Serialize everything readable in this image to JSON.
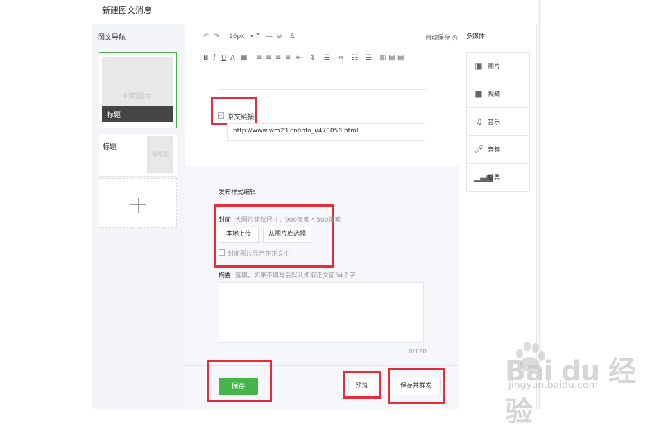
{
  "page": {
    "title": "新建图文消息"
  },
  "nav": {
    "header": "图文导航",
    "cover_card": {
      "placeholder": "封面图片",
      "title": "标题"
    },
    "sub_card": {
      "title": "标题",
      "thumb": "缩略图"
    }
  },
  "toolbar": {
    "font_size": "16px",
    "autosave": "自动保存"
  },
  "article": {
    "original_link": {
      "label": "原文链接",
      "checked": true,
      "url": "http://www.wm23.cn/info_i/470056.html"
    }
  },
  "publish": {
    "section_title": "发布样式编辑",
    "cover": {
      "label": "封面",
      "hint": "大图片建议尺寸：900像素 * 500像素",
      "upload_label": "本地上传",
      "library_label": "从图片库选择",
      "show_in_body_label": "封面图片显示在正文中"
    },
    "summary": {
      "label": "摘要",
      "hint": "选填，如果不填写会默认抓取正文前54个字",
      "counter": "0/120"
    }
  },
  "footer": {
    "save_label": "保存",
    "preview_label": "预览",
    "save_send_label": "保存并群发"
  },
  "media": {
    "header": "多媒体",
    "items": [
      {
        "icon": "image-icon",
        "label": "图片"
      },
      {
        "icon": "video-icon",
        "label": "视频"
      },
      {
        "icon": "music-icon",
        "label": "音乐"
      },
      {
        "icon": "microphone-icon",
        "label": "音频"
      },
      {
        "icon": "poll-icon",
        "label": "投票"
      }
    ]
  },
  "watermark": {
    "brand": "Bai du 经验",
    "url": "jingyan.baidu.com"
  },
  "colors": {
    "accent_green": "#44b549",
    "highlight_red": "#e52d3b"
  }
}
